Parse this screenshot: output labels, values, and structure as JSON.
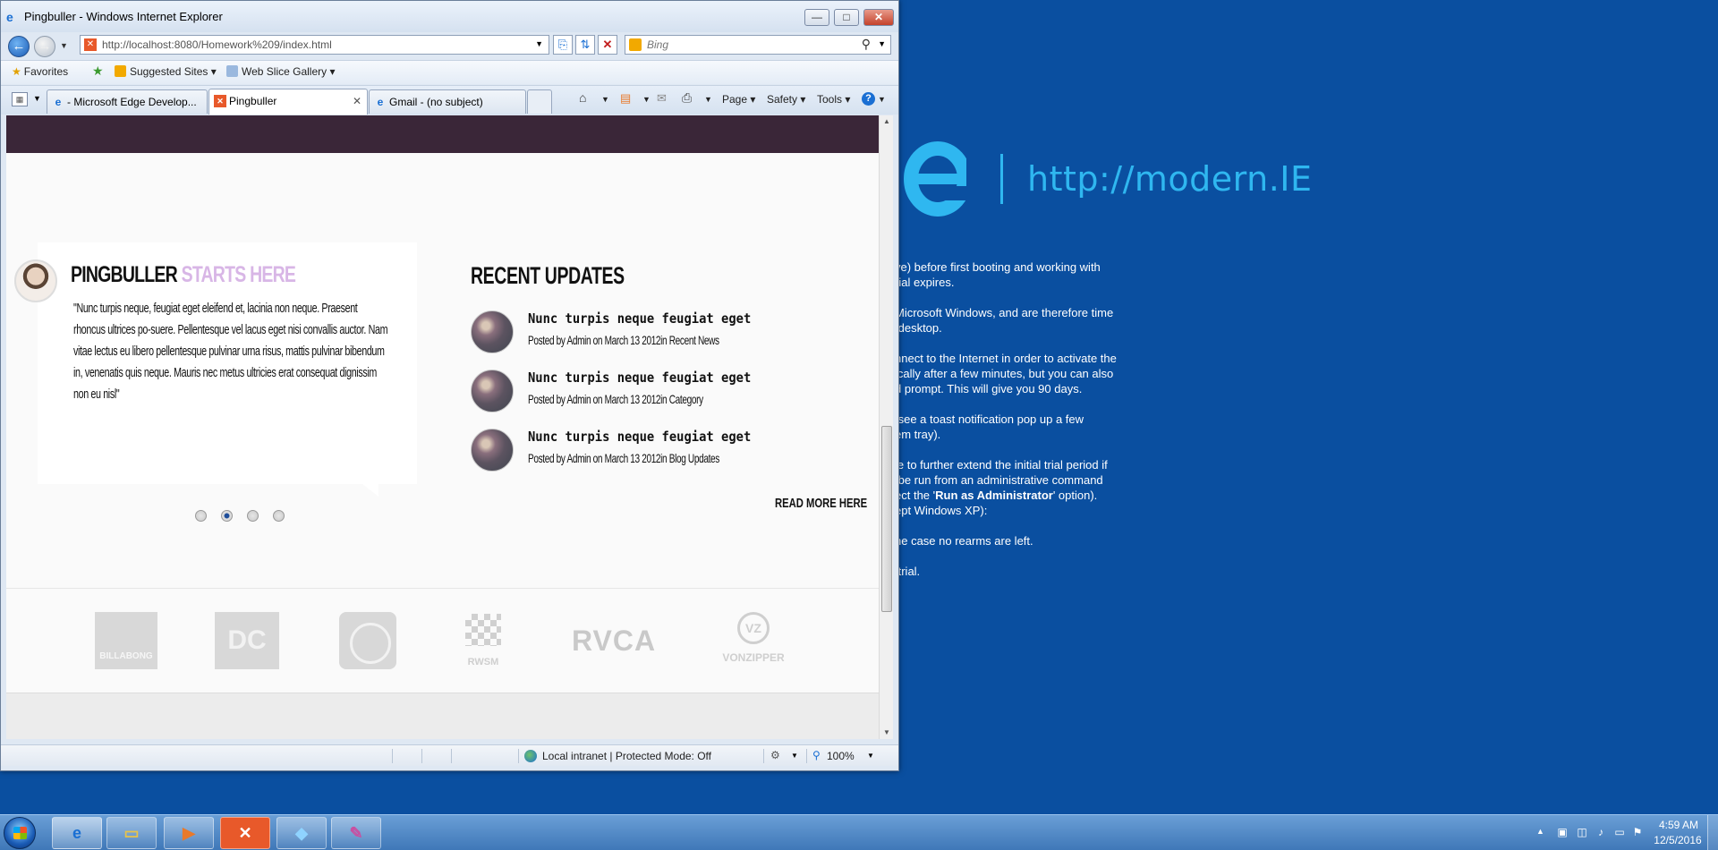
{
  "desktop": {
    "modernie_url": "http://modern.IE",
    "lines": [
      "ve) before first booting and working with\nrial expires.",
      "Microsoft Windows, and are therefore time\n desktop.",
      "nnect to the Internet in order to activate the\nically after a few minutes, but you can also\nd prompt. This will give you 90 days.",
      " see a toast notification pop up a few\nem tray).",
      "le to further extend the initial trial period if\n be run from an administrative command\nect the '",
      "he case no rearms are left.",
      " trial."
    ],
    "run_as_admin_bold": "Run as Administrator",
    "after_bold": "' option).\nept Windows XP):"
  },
  "window": {
    "title": "Pingbuller - Windows Internet Explorer",
    "minimize": "—",
    "maximize": "□",
    "close": "✕"
  },
  "addressbar": {
    "url": "http://localhost:8080/Homework%209/index.html",
    "search_placeholder": "Bing"
  },
  "favorites_bar": {
    "favorites": "Favorites",
    "suggested_sites": "Suggested Sites",
    "web_slice_gallery": "Web Slice Gallery"
  },
  "tabs": [
    {
      "label": "- Microsoft Edge Develop...",
      "active": false
    },
    {
      "label": "Pingbuller",
      "active": true
    },
    {
      "label": "Gmail - (no subject)",
      "active": false
    }
  ],
  "command_bar": {
    "page": "Page",
    "safety": "Safety",
    "tools": "Tools",
    "help": "?"
  },
  "page": {
    "testimonial": {
      "title_main": "PINGBULLER",
      "title_accent": "STARTS HERE",
      "quote": "\"Nunc turpis neque, feugiat eget eleifend et, lacinia non neque. Praesent rhoncus ultrices po-suere. Pellentesque vel lacus eget nisi convallis auctor. Nam vitae lectus eu libero pellentesque pulvinar urna risus, mattis pulvinar bibendum in, venenatis quis neque. Mauris nec metus ultricies erat consequat dignissim non eu nisl\""
    },
    "slider": {
      "count": 4,
      "active_index": 1
    },
    "recent": {
      "title": "RECENT UPDATES",
      "items": [
        {
          "headline": "Nunc turpis neque feugiat eget",
          "meta": "Posted by Admin on March 13 2012in Recent News"
        },
        {
          "headline": "Nunc turpis neque feugiat eget",
          "meta": "Posted by Admin on March 13 2012in Category"
        },
        {
          "headline": "Nunc turpis neque feugiat eget",
          "meta": "Posted by Admin on March 13 2012in Blog Updates"
        }
      ],
      "read_more": "READ MORE HERE"
    },
    "brands": {
      "billabong": "BILLABONG",
      "dc": "DC",
      "rwsm": "RWSM",
      "rvca": "RVCA",
      "vonzipper_mark": "VZ",
      "vonzipper": "VONZIPPER"
    }
  },
  "statusbar": {
    "zone": "Local intranet | Protected Mode: Off",
    "zoom": "100%"
  },
  "taskbar": {
    "time": "4:59 AM",
    "date": "12/5/2016"
  },
  "colors": {
    "desktop_bg": "#0a4fa0",
    "site_header": "#3a2638",
    "title_accent": "#d8b6e6",
    "modernie_blue": "#2fb7f0"
  }
}
